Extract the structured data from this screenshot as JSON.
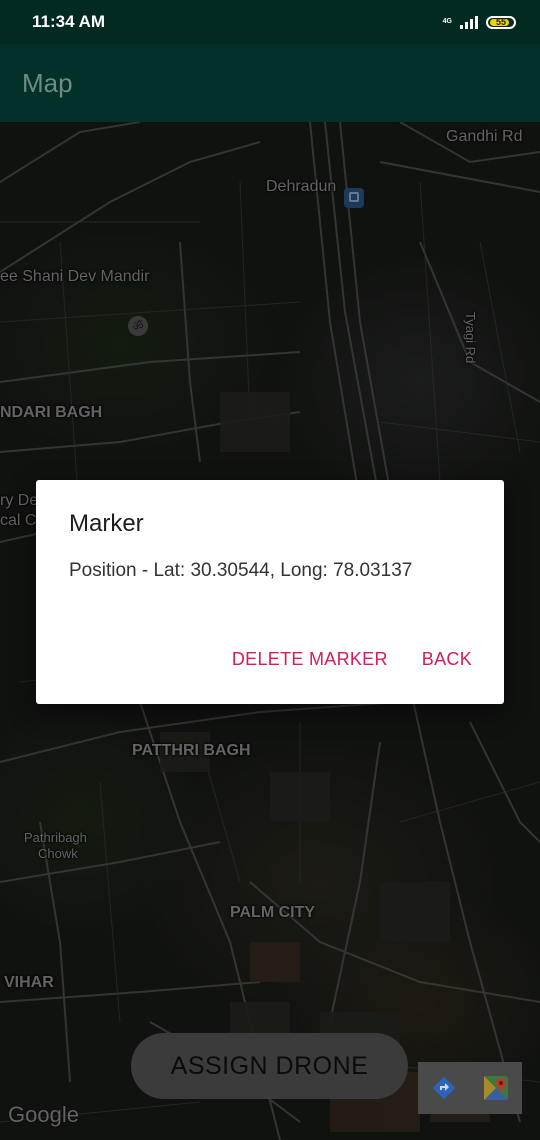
{
  "status_bar": {
    "time": "11:34 AM",
    "network_type": "4G",
    "battery_level": "55",
    "battery_color": "#f3d000"
  },
  "app_bar": {
    "title": "Map",
    "background": "#033028"
  },
  "map": {
    "labels": {
      "gandhi_rd": "Gandhi Rd",
      "dehradun": "Dehradun",
      "shani_dev": "ee Shani Dev Mandir",
      "tyagi_rd": "Tyagi Rd",
      "ndari_bagh": "NDARI BAGH",
      "ry_de": "ry De",
      "cal_c": "cal C",
      "patthri_bagh": "PATTHRI BAGH",
      "pathribagh_chowk_1": "Pathribagh",
      "pathribagh_chowk_2": "Chowk",
      "palm_city": "PALM CITY",
      "vihar": "VIHAR"
    },
    "attribution": "Google",
    "icons": [
      "railway-station-icon",
      "temple-icon",
      "directions-icon",
      "google-maps-icon"
    ]
  },
  "assign_button": {
    "label": "ASSIGN DRONE"
  },
  "dialog": {
    "title": "Marker",
    "message": "Position - Lat: 30.30544, Long: 78.03137",
    "delete_label": "DELETE MARKER",
    "back_label": "BACK",
    "accent_color": "#d81b60"
  }
}
